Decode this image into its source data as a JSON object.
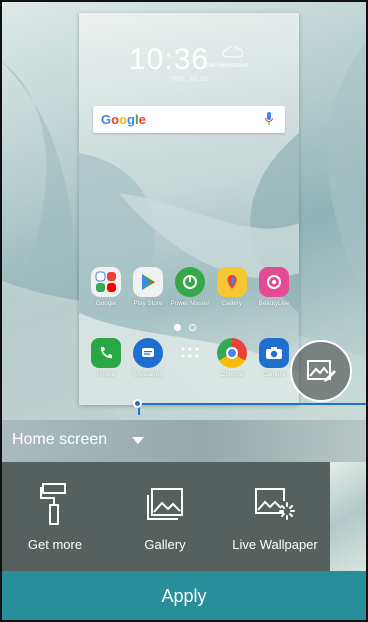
{
  "preview": {
    "time": "10:36",
    "weather": "No connection",
    "date": "Mon, Jul 10",
    "search_logo": "Google",
    "apps": [
      {
        "label": "Google",
        "color": "#f1f1f1"
      },
      {
        "label": "Play Store",
        "color": "#f1f1f1"
      },
      {
        "label": "Power Master",
        "color": "#36a84a"
      },
      {
        "label": "Gallery",
        "color": "#f6c633"
      },
      {
        "label": "BeautyLive",
        "color": "#e64a95"
      }
    ],
    "dock": [
      {
        "label": "Phone",
        "color": "#28a745"
      },
      {
        "label": "Messages",
        "color": "#1f6fd1"
      },
      {
        "label": "",
        "color": "transparent"
      },
      {
        "label": "Chrome",
        "color": "#ffffff"
      },
      {
        "label": "Camera",
        "color": "#1f6fd1"
      }
    ]
  },
  "selector": {
    "label": "Home screen"
  },
  "options": [
    {
      "label": "Get more",
      "icon": "paint-roller-icon"
    },
    {
      "label": "Gallery",
      "icon": "gallery-icon"
    },
    {
      "label": "Live Wallpaper",
      "icon": "live-wallpaper-icon"
    }
  ],
  "apply_label": "Apply",
  "colors": {
    "accent": "#288f9a",
    "pointer": "#1b74c8",
    "options_bg": "#55605f"
  }
}
